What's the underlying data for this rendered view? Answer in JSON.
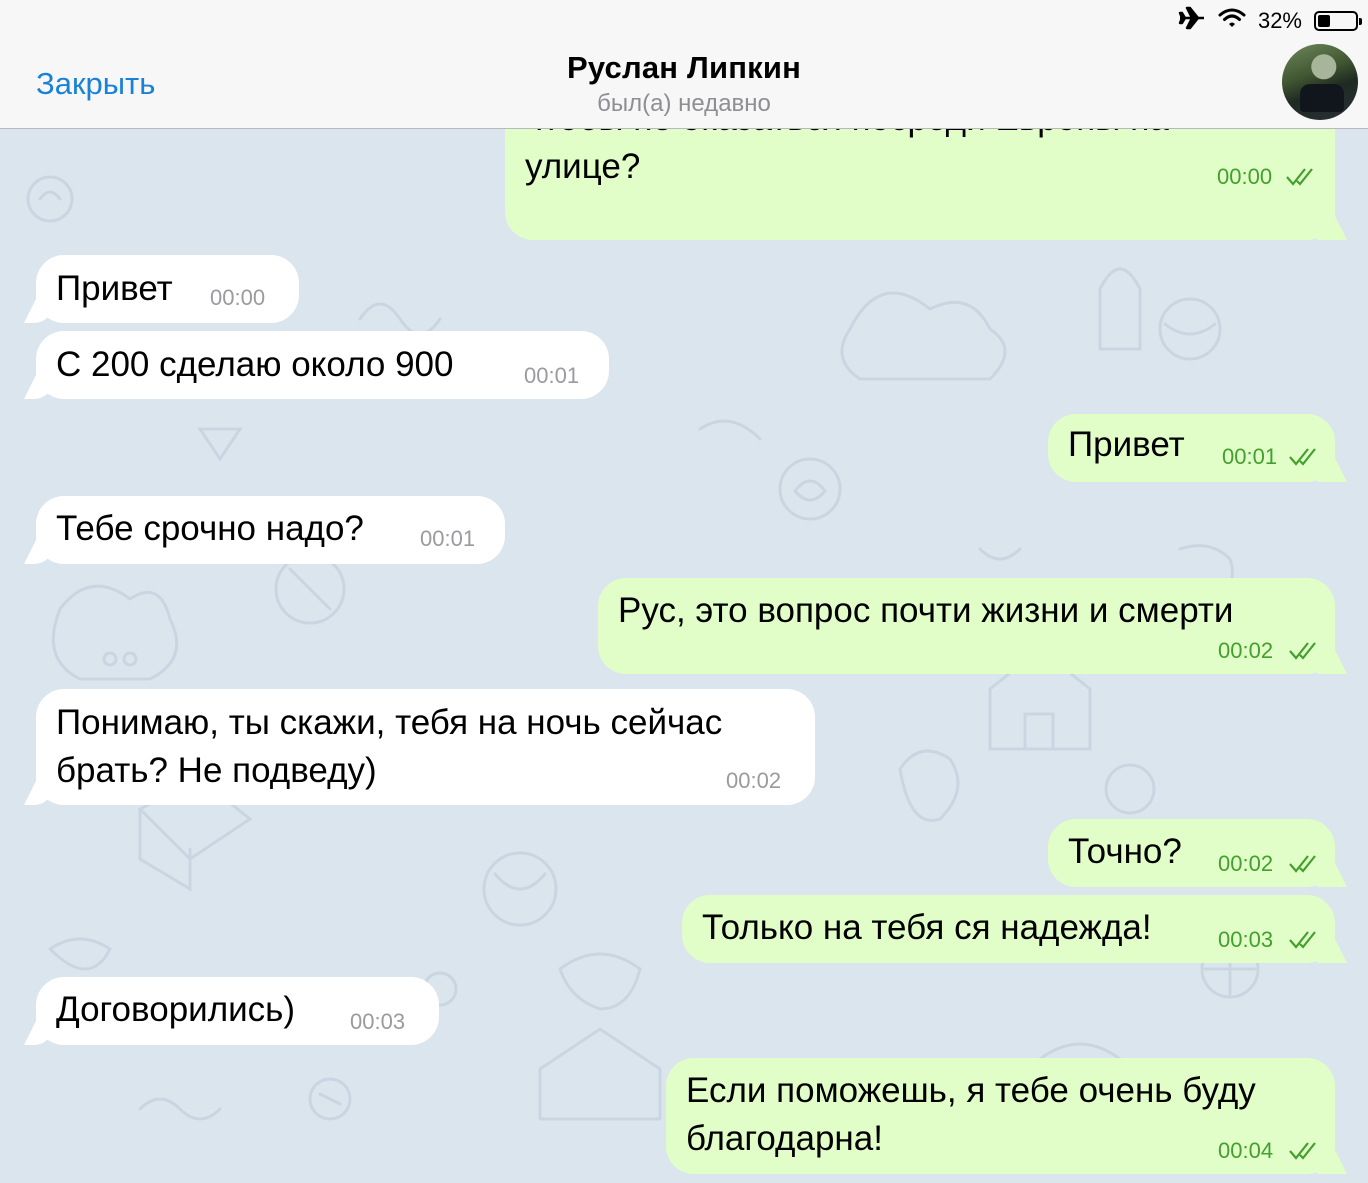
{
  "status_bar": {
    "battery_percent": "32%",
    "battery_level": 0.32,
    "icons": [
      "airplane-icon",
      "wifi-icon",
      "battery-icon"
    ]
  },
  "header": {
    "close_label": "Закрыть",
    "contact_name": "Руслан Липкин",
    "contact_status": "был(а) недавно"
  },
  "colors": {
    "accent": "#1a82d6",
    "incoming_bubble": "#ffffff",
    "outgoing_bubble": "#e2fec8",
    "outgoing_time": "#43a02e",
    "chat_background": "#dbe5ee"
  },
  "messages": [
    {
      "direction": "out",
      "lines": [
        "чтобы не оказаться посреди Европы на",
        "улице?"
      ],
      "time": "00:00",
      "read": true
    },
    {
      "direction": "in",
      "lines": [
        "Привет"
      ],
      "time": "00:00"
    },
    {
      "direction": "in",
      "lines": [
        "С 200 сделаю около 900"
      ],
      "time": "00:01"
    },
    {
      "direction": "out",
      "lines": [
        "Привет"
      ],
      "time": "00:01",
      "read": true
    },
    {
      "direction": "in",
      "lines": [
        "Тебе срочно надо?"
      ],
      "time": "00:01"
    },
    {
      "direction": "out",
      "lines": [
        "Рус, это вопрос почти жизни и смерти"
      ],
      "time": "00:02",
      "read": true
    },
    {
      "direction": "in",
      "lines": [
        "Понимаю, ты скажи, тебя на ночь сейчас",
        "брать? Не подведу)"
      ],
      "time": "00:02"
    },
    {
      "direction": "out",
      "lines": [
        "Точно?"
      ],
      "time": "00:02",
      "read": true
    },
    {
      "direction": "out",
      "lines": [
        "Только на тебя ся надежда!"
      ],
      "time": "00:03",
      "read": true
    },
    {
      "direction": "in",
      "lines": [
        "Договорились)"
      ],
      "time": "00:03"
    },
    {
      "direction": "out",
      "lines": [
        "Если поможешь, я тебе очень буду",
        "благодарна!"
      ],
      "time": "00:04",
      "read": true
    }
  ]
}
